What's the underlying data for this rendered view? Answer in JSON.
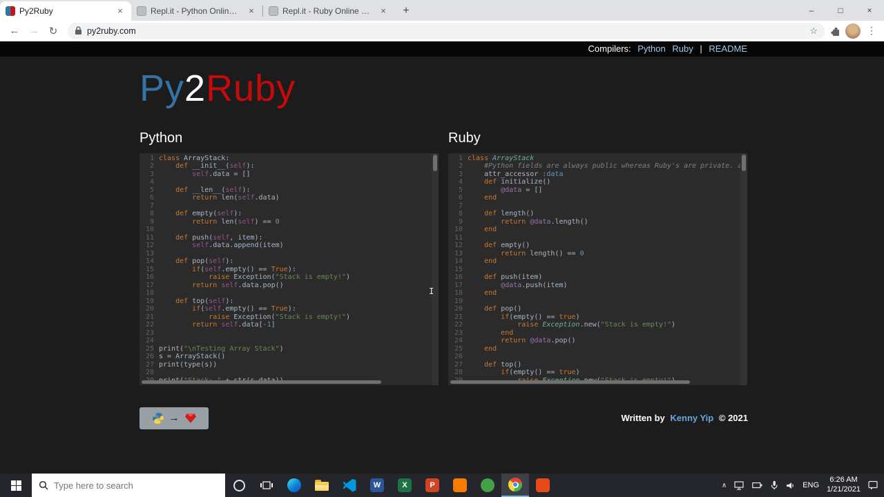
{
  "browser": {
    "tabs": [
      {
        "title": "Py2Ruby"
      },
      {
        "title": "Repl.it - Python Online Compiler"
      },
      {
        "title": "Repl.it - Ruby Online Compiler &"
      }
    ],
    "url": "py2ruby.com",
    "icons": {
      "back": "←",
      "forward": "→",
      "reload": "↻",
      "star": "☆",
      "menu": "⋮",
      "minimize": "–",
      "maximize": "□",
      "close": "×",
      "tab_close": "×",
      "new_tab": "+"
    }
  },
  "page": {
    "compilers_bar": {
      "label": "Compilers:",
      "python_link": "Python",
      "ruby_link": "Ruby",
      "separator": "|",
      "readme_link": "README"
    },
    "logo": {
      "py": "Py",
      "two": "2",
      "ruby": "Ruby"
    },
    "badge_arrow": "→",
    "footer": {
      "prefix": "Written by",
      "author": "Kenny Yip",
      "suffix": "© 2021"
    }
  },
  "code": {
    "python": {
      "title": "Python",
      "lines": [
        [
          [
            "k",
            "class "
          ],
          [
            "p",
            "ArrayStack:"
          ]
        ],
        [
          [
            "p",
            "    "
          ],
          [
            "k",
            "def "
          ],
          [
            "p",
            "__init__("
          ],
          [
            "v",
            "self"
          ],
          [
            "p",
            "):"
          ]
        ],
        [
          [
            "p",
            "        "
          ],
          [
            "v",
            "self"
          ],
          [
            "p",
            ".data = []"
          ]
        ],
        [],
        [
          [
            "p",
            "    "
          ],
          [
            "k",
            "def "
          ],
          [
            "p",
            "__len__("
          ],
          [
            "v",
            "self"
          ],
          [
            "p",
            "):"
          ]
        ],
        [
          [
            "p",
            "        "
          ],
          [
            "k",
            "return "
          ],
          [
            "p",
            "len("
          ],
          [
            "v",
            "self"
          ],
          [
            "p",
            ".data)"
          ]
        ],
        [],
        [
          [
            "p",
            "    "
          ],
          [
            "k",
            "def "
          ],
          [
            "p",
            "empty("
          ],
          [
            "v",
            "self"
          ],
          [
            "p",
            "):"
          ]
        ],
        [
          [
            "p",
            "        "
          ],
          [
            "k",
            "return "
          ],
          [
            "p",
            "len("
          ],
          [
            "v",
            "self"
          ],
          [
            "p",
            ") == "
          ],
          [
            "n",
            "0"
          ]
        ],
        [],
        [
          [
            "p",
            "    "
          ],
          [
            "k",
            "def "
          ],
          [
            "p",
            "push("
          ],
          [
            "v",
            "self"
          ],
          [
            "p",
            ", item):"
          ]
        ],
        [
          [
            "p",
            "        "
          ],
          [
            "v",
            "self"
          ],
          [
            "p",
            ".data.append(item)"
          ]
        ],
        [],
        [
          [
            "p",
            "    "
          ],
          [
            "k",
            "def "
          ],
          [
            "p",
            "pop("
          ],
          [
            "v",
            "self"
          ],
          [
            "p",
            "):"
          ]
        ],
        [
          [
            "p",
            "        "
          ],
          [
            "k",
            "if"
          ],
          [
            "p",
            "("
          ],
          [
            "v",
            "self"
          ],
          [
            "p",
            ".empty() == "
          ],
          [
            "k",
            "True"
          ],
          [
            "p",
            "):"
          ]
        ],
        [
          [
            "p",
            "            "
          ],
          [
            "k",
            "raise "
          ],
          [
            "p",
            "Exception("
          ],
          [
            "s",
            "\"Stack is empty!\""
          ],
          [
            "p",
            ")"
          ]
        ],
        [
          [
            "p",
            "        "
          ],
          [
            "k",
            "return "
          ],
          [
            "v",
            "self"
          ],
          [
            "p",
            ".data.pop()"
          ]
        ],
        [],
        [
          [
            "p",
            "    "
          ],
          [
            "k",
            "def "
          ],
          [
            "p",
            "top("
          ],
          [
            "v",
            "self"
          ],
          [
            "p",
            "):"
          ]
        ],
        [
          [
            "p",
            "        "
          ],
          [
            "k",
            "if"
          ],
          [
            "p",
            "("
          ],
          [
            "v",
            "self"
          ],
          [
            "p",
            ".empty() == "
          ],
          [
            "k",
            "True"
          ],
          [
            "p",
            "):"
          ]
        ],
        [
          [
            "p",
            "            "
          ],
          [
            "k",
            "raise "
          ],
          [
            "p",
            "Exception("
          ],
          [
            "s",
            "\"Stack is empty!\""
          ],
          [
            "p",
            ")"
          ]
        ],
        [
          [
            "p",
            "        "
          ],
          [
            "k",
            "return "
          ],
          [
            "v",
            "self"
          ],
          [
            "p",
            ".data["
          ],
          [
            "n",
            "-1"
          ],
          [
            "p",
            "]"
          ]
        ],
        [],
        [],
        [
          [
            "p",
            "print("
          ],
          [
            "s",
            "\"\\nTesting Array Stack\""
          ],
          [
            "p",
            ")"
          ]
        ],
        [
          [
            "p",
            "s = ArrayStack()"
          ]
        ],
        [
          [
            "p",
            "print(type(s))"
          ]
        ],
        [],
        [
          [
            "p",
            "print("
          ],
          [
            "s",
            "\"Stack: \""
          ],
          [
            "p",
            " + str(s.data))"
          ]
        ]
      ]
    },
    "ruby": {
      "title": "Ruby",
      "lines": [
        [
          [
            "k",
            "class "
          ],
          [
            "t",
            "ArrayStack"
          ]
        ],
        [
          [
            "p",
            "    "
          ],
          [
            "c",
            "#Python fields are always public whereas Ruby's are private. attr_accessor"
          ]
        ],
        [
          [
            "p",
            "    attr_accessor "
          ],
          [
            "n",
            ":data"
          ]
        ],
        [
          [
            "p",
            "    "
          ],
          [
            "k",
            "def "
          ],
          [
            "p",
            "initialize()"
          ]
        ],
        [
          [
            "p",
            "        "
          ],
          [
            "i",
            "@data"
          ],
          [
            "p",
            " = []"
          ]
        ],
        [
          [
            "p",
            "    "
          ],
          [
            "k",
            "end"
          ]
        ],
        [],
        [
          [
            "p",
            "    "
          ],
          [
            "k",
            "def "
          ],
          [
            "p",
            "length()"
          ]
        ],
        [
          [
            "p",
            "        "
          ],
          [
            "k",
            "return "
          ],
          [
            "i",
            "@data"
          ],
          [
            "p",
            ".length()"
          ]
        ],
        [
          [
            "p",
            "    "
          ],
          [
            "k",
            "end"
          ]
        ],
        [],
        [
          [
            "p",
            "    "
          ],
          [
            "k",
            "def "
          ],
          [
            "p",
            "empty()"
          ]
        ],
        [
          [
            "p",
            "        "
          ],
          [
            "k",
            "return "
          ],
          [
            "p",
            "length() == "
          ],
          [
            "n",
            "0"
          ]
        ],
        [
          [
            "p",
            "    "
          ],
          [
            "k",
            "end"
          ]
        ],
        [],
        [
          [
            "p",
            "    "
          ],
          [
            "k",
            "def "
          ],
          [
            "p",
            "push(item)"
          ]
        ],
        [
          [
            "p",
            "        "
          ],
          [
            "i",
            "@data"
          ],
          [
            "p",
            ".push(item)"
          ]
        ],
        [
          [
            "p",
            "    "
          ],
          [
            "k",
            "end"
          ]
        ],
        [],
        [
          [
            "p",
            "    "
          ],
          [
            "k",
            "def "
          ],
          [
            "p",
            "pop()"
          ]
        ],
        [
          [
            "p",
            "        "
          ],
          [
            "k",
            "if"
          ],
          [
            "p",
            "(empty() == "
          ],
          [
            "k",
            "true"
          ],
          [
            "p",
            ")"
          ]
        ],
        [
          [
            "p",
            "            "
          ],
          [
            "k",
            "raise "
          ],
          [
            "t",
            "Exception"
          ],
          [
            "p",
            ".new("
          ],
          [
            "s",
            "\"Stack is empty!\""
          ],
          [
            "p",
            ")"
          ]
        ],
        [
          [
            "p",
            "        "
          ],
          [
            "k",
            "end"
          ]
        ],
        [
          [
            "p",
            "        "
          ],
          [
            "k",
            "return "
          ],
          [
            "i",
            "@data"
          ],
          [
            "p",
            ".pop()"
          ]
        ],
        [
          [
            "p",
            "    "
          ],
          [
            "k",
            "end"
          ]
        ],
        [],
        [
          [
            "p",
            "    "
          ],
          [
            "k",
            "def "
          ],
          [
            "p",
            "top()"
          ]
        ],
        [
          [
            "p",
            "        "
          ],
          [
            "k",
            "if"
          ],
          [
            "p",
            "(empty() == "
          ],
          [
            "k",
            "true"
          ],
          [
            "p",
            ")"
          ]
        ],
        [
          [
            "p",
            "            "
          ],
          [
            "k",
            "raise "
          ],
          [
            "t",
            "Exception"
          ],
          [
            "p",
            ".new("
          ],
          [
            "s",
            "\"Stack is empty!\""
          ],
          [
            "p",
            ")"
          ]
        ]
      ]
    }
  },
  "taskbar": {
    "search_placeholder": "Type here to search",
    "apps": [
      "start",
      "search",
      "cortana",
      "task-view",
      "edge",
      "file-explorer",
      "vscode",
      "word",
      "excel",
      "powerpoint",
      "app-orange",
      "app-green",
      "chrome",
      "app-red"
    ],
    "office_letters": {
      "word": "W",
      "excel": "X",
      "powerpoint": "P"
    },
    "tray": {
      "chevron": "∧",
      "language": "ENG",
      "time": "6:26 AM",
      "date": "1/21/2021"
    }
  }
}
